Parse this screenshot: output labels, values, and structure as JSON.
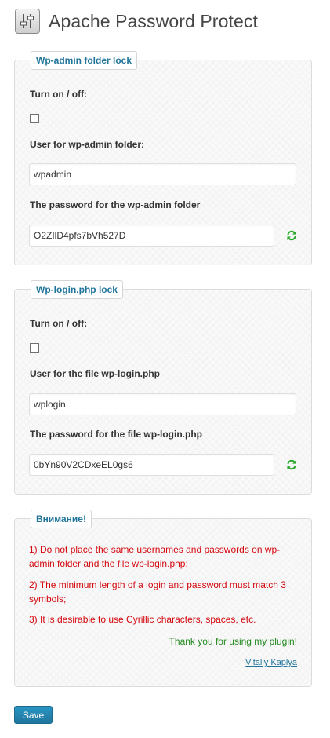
{
  "page": {
    "title": "Apache Password Protect"
  },
  "admin_lock": {
    "legend": "Wp-admin folder lock",
    "toggle_label": "Turn on / off:",
    "toggle_checked": false,
    "user_label": "User for wp-admin folder:",
    "user_value": "wpadmin",
    "password_label": "The password for the wp-admin folder",
    "password_value": "O2ZIlD4pfs7bVh527D",
    "icons": {
      "refresh": "refresh-icon"
    }
  },
  "login_lock": {
    "legend": "Wp-login.php lock",
    "toggle_label": "Turn on / off:",
    "toggle_checked": false,
    "user_label": "User for the file wp-login.php",
    "user_value": "wplogin",
    "password_label": "The password for the file wp-login.php",
    "password_value": "0bYn90V2CDxeEL0gs6",
    "icons": {
      "refresh": "refresh-icon"
    }
  },
  "notice": {
    "legend": "Внимание!",
    "items": [
      "1) Do not place the same usernames and passwords on wp-admin folder and the file wp-login.php;",
      "2) The minimum length of a login and password must match 3 symbols;",
      "3) It is desirable to use Cyrillic characters, spaces, etc."
    ],
    "thanks": "Thank you for using my plugin!",
    "author": "Vitaliy Kaplya"
  },
  "actions": {
    "save_label": "Save"
  },
  "colors": {
    "accent": "#21759b",
    "warning": "#d4070d",
    "success": "#238a1f",
    "refresh_icon": "#2ea82e"
  }
}
